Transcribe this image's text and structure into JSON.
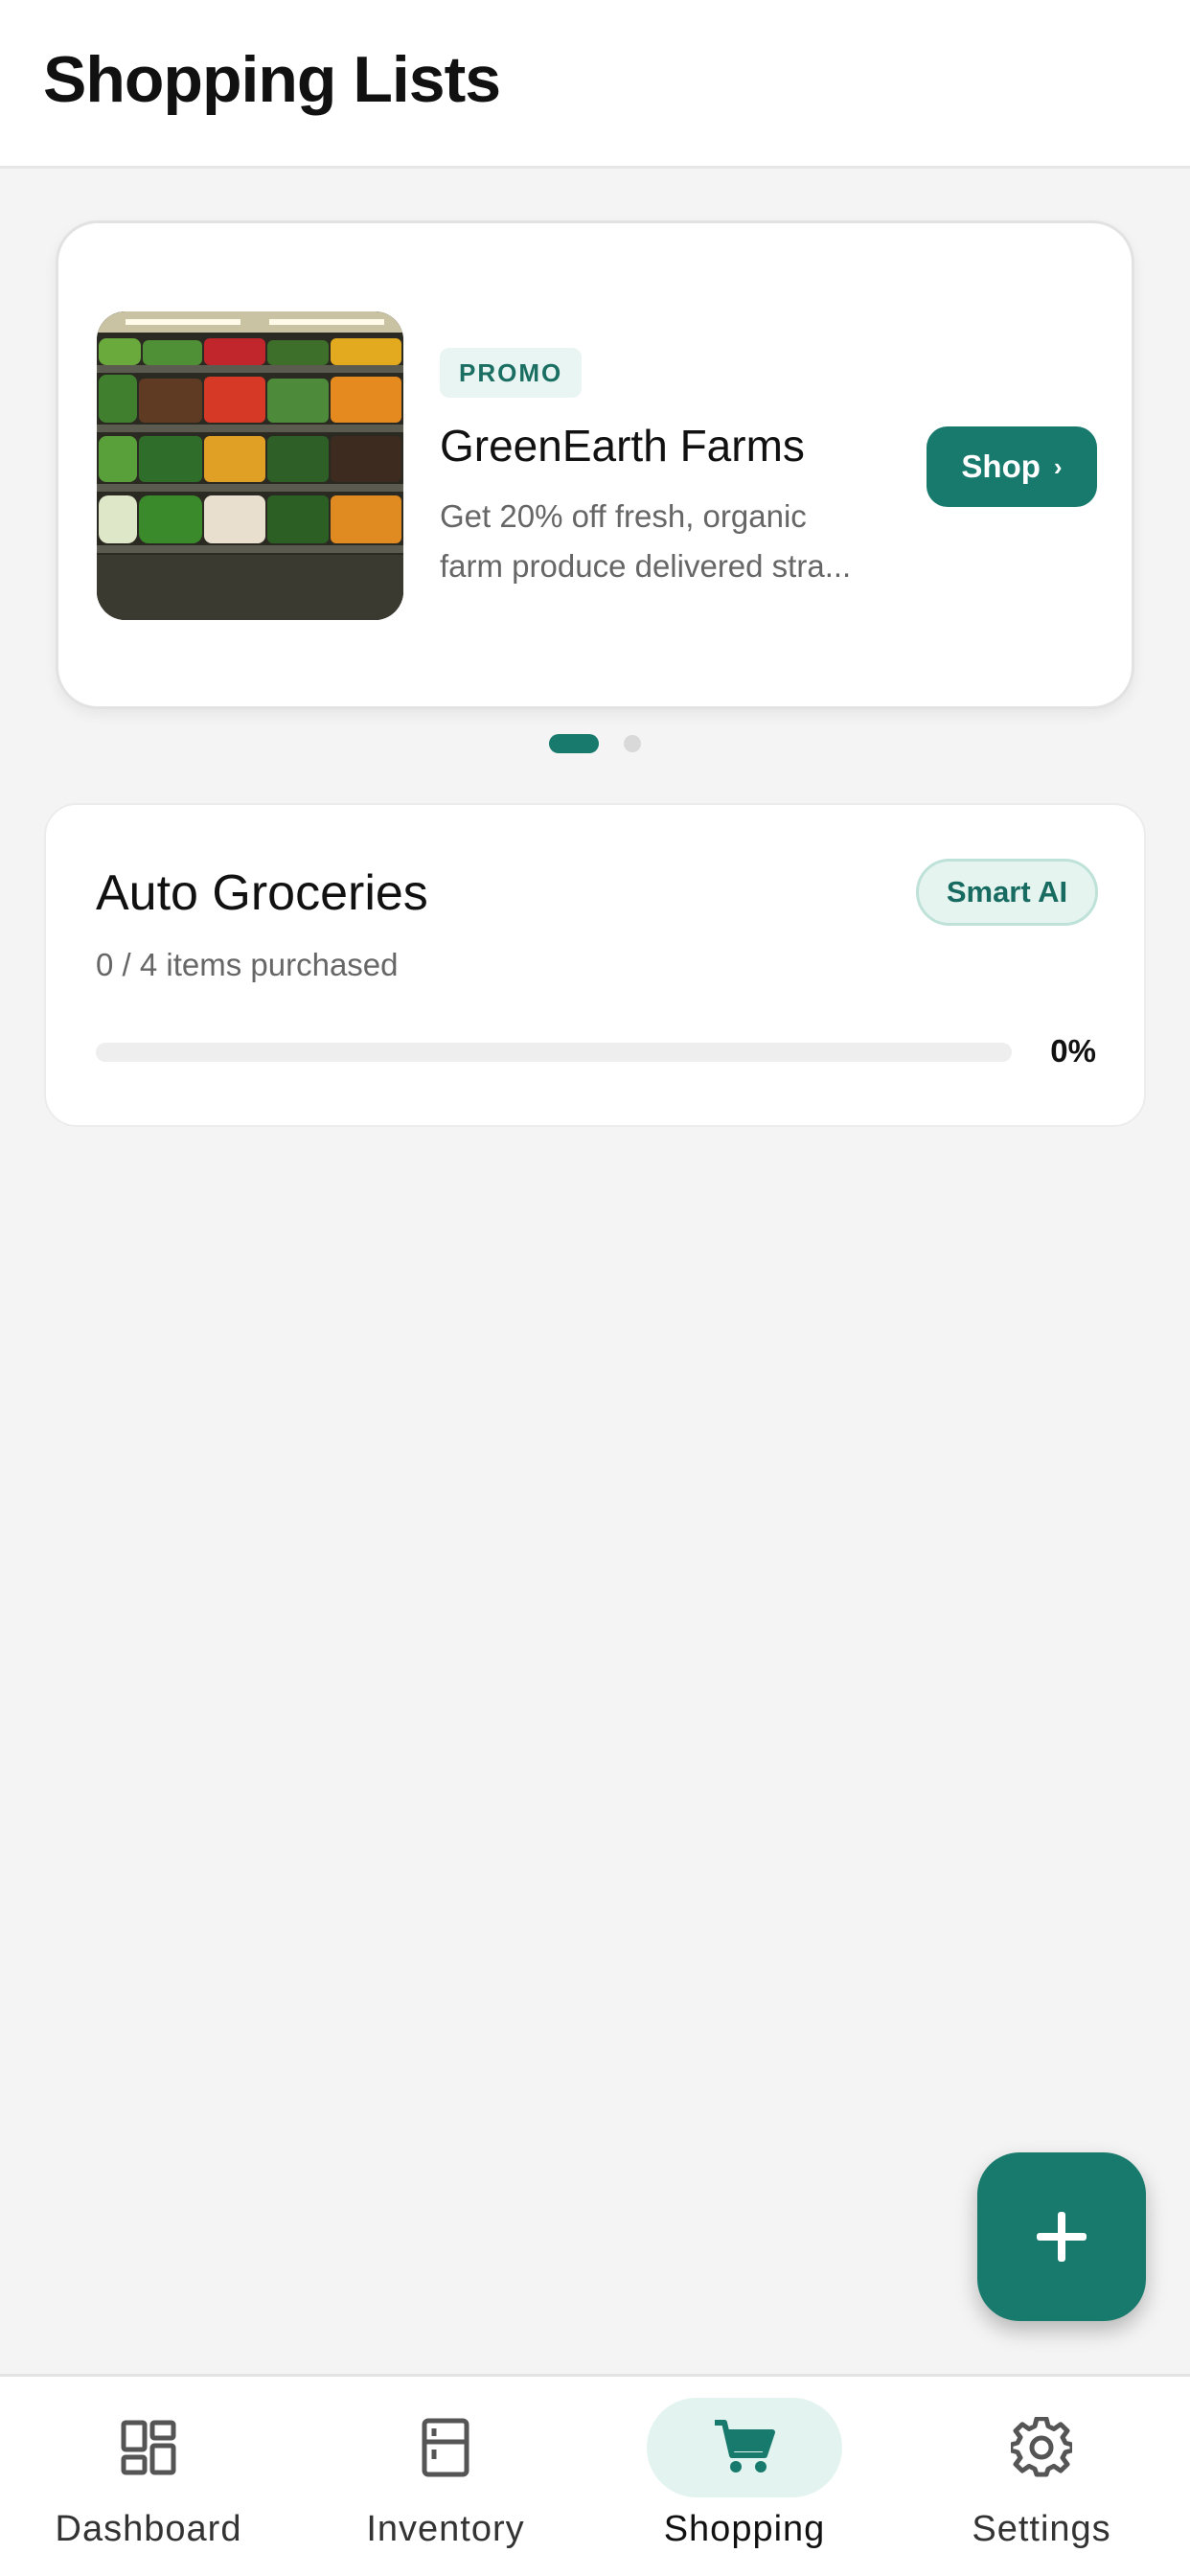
{
  "header": {
    "title": "Shopping Lists"
  },
  "promo": {
    "badge": "PROMO",
    "title": "GreenEarth Farms",
    "description_line1": "Get 20% off fresh, organic",
    "description_line2": "farm produce delivered stra...",
    "button_label": "Shop",
    "button_chevron": "›",
    "image": "grocery-shelf-produce-photo",
    "active_slide": 1,
    "slide_count": 2
  },
  "list": {
    "title": "Auto Groceries",
    "badge": "Smart AI",
    "subtitle": "0 / 4 items purchased",
    "progress_percent": 0,
    "progress_label": "0%"
  },
  "fab": {
    "icon": "plus-icon"
  },
  "nav": {
    "items": [
      {
        "label": "Dashboard",
        "icon": "dashboard-icon",
        "active": false
      },
      {
        "label": "Inventory",
        "icon": "fridge-icon",
        "active": false
      },
      {
        "label": "Shopping",
        "icon": "cart-icon",
        "active": true
      },
      {
        "label": "Settings",
        "icon": "gear-icon",
        "active": false
      }
    ]
  },
  "colors": {
    "accent": "#177a6d",
    "accent_soft": "#e3f3ef",
    "background": "#f4f4f4",
    "card": "#ffffff"
  }
}
